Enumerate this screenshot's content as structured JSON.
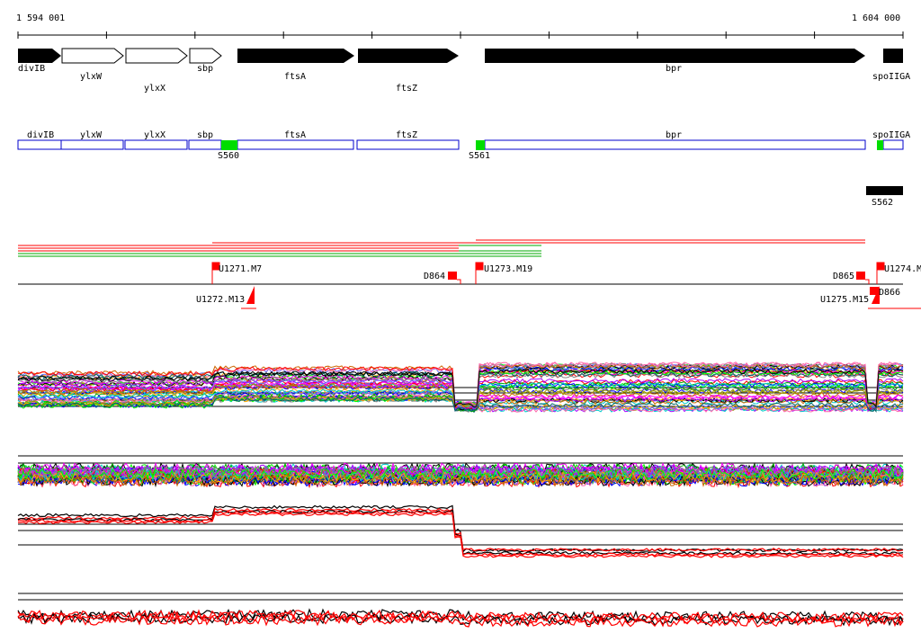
{
  "coordinates": {
    "start_label": "1 594 001",
    "end_label": "1 604 000"
  },
  "gene_track": {
    "genes": [
      {
        "name": "divIB",
        "style": "filled"
      },
      {
        "name": "ylxW",
        "style": "outline"
      },
      {
        "name": "ylxX",
        "style": "outline"
      },
      {
        "name": "sbp",
        "style": "outline"
      },
      {
        "name": "ftsA",
        "style": "filled"
      },
      {
        "name": "ftsZ",
        "style": "filled"
      },
      {
        "name": "bpr",
        "style": "filled"
      },
      {
        "name": "spoIIGA",
        "style": "filled"
      }
    ]
  },
  "segment_track": {
    "boxes": [
      "divIB",
      "ylxW",
      "ylxX",
      "sbp",
      "ftsA",
      "ftsZ",
      "bpr",
      "spoIIGA"
    ],
    "promoters": [
      "S560",
      "S561"
    ],
    "extra_feature": "S562"
  },
  "transcription_units": {
    "upstream": [
      "U1271.M7",
      "U1273.M19",
      "U1274.M"
    ],
    "downstream": [
      "U1272.M13",
      "U1275.M15"
    ],
    "terminators": [
      "D864",
      "D865",
      "D866"
    ]
  },
  "colors": {
    "gene_fill": "#000000",
    "segment_outline": "#0000cc",
    "promoter": "#00dd00",
    "unit_marker": "#ff0000",
    "upper_strand_lines": "#ff0000",
    "lower_strand_lines": "#00aa00"
  }
}
